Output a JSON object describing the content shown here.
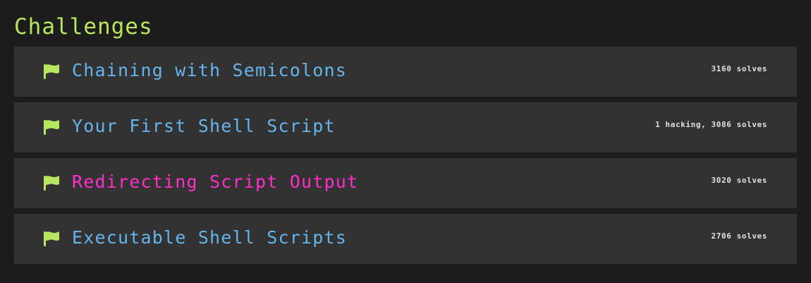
{
  "page": {
    "title": "Challenges"
  },
  "colors": {
    "title": "#b9e660",
    "flag": "#b9e660",
    "link": "#63b5ec",
    "active_link": "#ff2ecb"
  },
  "challenges": [
    {
      "name": "Chaining with Semicolons",
      "stats": "3160 solves",
      "icon": "flag-icon",
      "active": false
    },
    {
      "name": "Your First Shell Script",
      "stats": "1 hacking, 3086 solves",
      "icon": "flag-icon",
      "active": false
    },
    {
      "name": "Redirecting Script Output",
      "stats": "3020 solves",
      "icon": "flag-icon",
      "active": true
    },
    {
      "name": "Executable Shell Scripts",
      "stats": "2706 solves",
      "icon": "flag-icon",
      "active": false
    }
  ]
}
